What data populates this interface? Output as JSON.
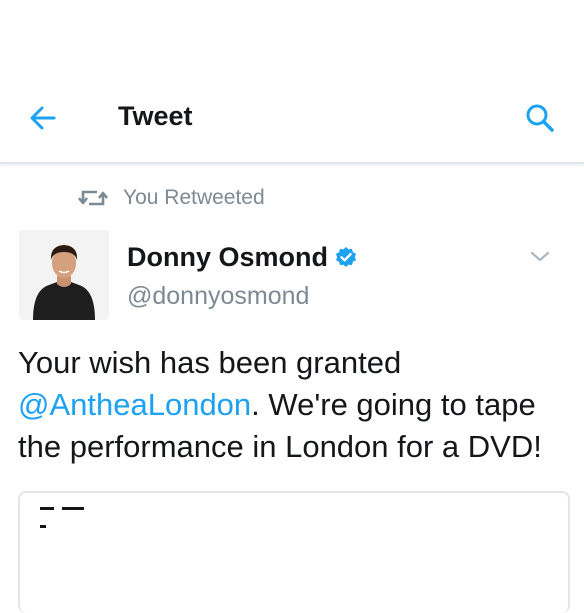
{
  "header": {
    "title": "Tweet"
  },
  "retweet": {
    "label": "You Retweeted"
  },
  "tweet": {
    "author": {
      "display_name": "Donny Osmond",
      "handle": "@donnyosmond",
      "verified": true
    },
    "text_before": "Your wish has been granted ",
    "mention": "@AntheaLondon",
    "text_after": ". We're going to tape the performance in London for a DVD!"
  },
  "icons": {
    "back": "arrow-left-icon",
    "search": "search-icon",
    "retweet": "retweet-icon",
    "verified": "verified-badge-icon",
    "caret": "chevron-down-icon"
  },
  "colors": {
    "accent": "#1da1f2",
    "text": "#14171a",
    "secondary": "#7d8a94",
    "divider": "#e1e6ea"
  }
}
